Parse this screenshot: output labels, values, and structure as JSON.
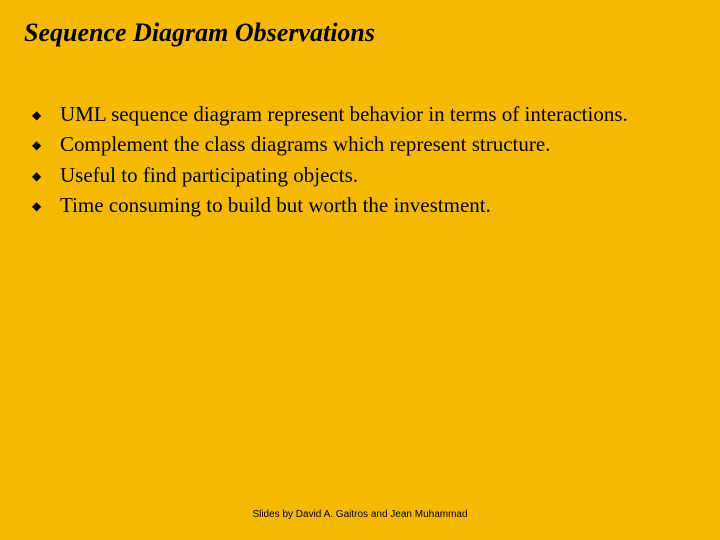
{
  "title": "Sequence Diagram Observations",
  "bullets": [
    "UML sequence diagram represent behavior in terms of interactions.",
    "Complement the class diagrams which represent structure.",
    "Useful to find participating objects.",
    "Time consuming to build but worth the investment."
  ],
  "footer": "Slides by David A. Gaitros and Jean Muhammad"
}
